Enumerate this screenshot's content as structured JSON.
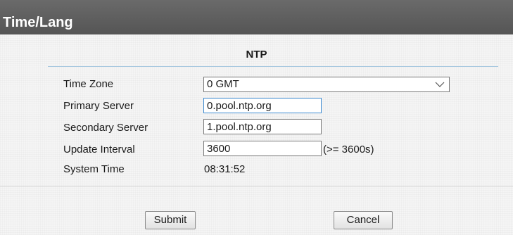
{
  "header": {
    "title": "Time/Lang"
  },
  "section": {
    "title": "NTP"
  },
  "form": {
    "time_zone": {
      "label": "Time Zone",
      "value": "0 GMT"
    },
    "primary_server": {
      "label": "Primary Server",
      "value": "0.pool.ntp.org"
    },
    "secondary_server": {
      "label": "Secondary Server",
      "value": "1.pool.ntp.org"
    },
    "update_interval": {
      "label": "Update Interval",
      "value": "3600",
      "hint": "(>= 3600s)"
    },
    "system_time": {
      "label": "System Time",
      "value": "08:31:52"
    }
  },
  "buttons": {
    "submit": "Submit",
    "cancel": "Cancel"
  },
  "colors": {
    "titlebar": "#5f5f5f",
    "focus_border": "#3c8ad0",
    "section_rule": "#a8c8e0"
  },
  "icons": {
    "dropdown": "chevron-down-icon"
  }
}
